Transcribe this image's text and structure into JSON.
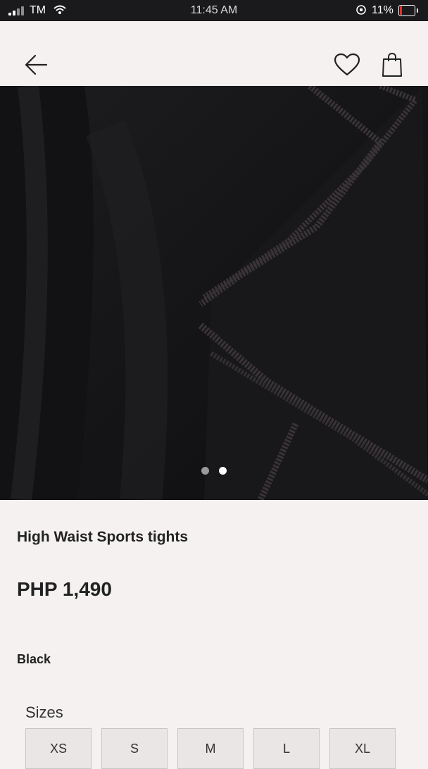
{
  "status_bar": {
    "carrier": "TM",
    "time": "11:45 AM",
    "battery": "11%"
  },
  "header": {
    "back_icon": "arrow-left-icon",
    "wishlist_icon": "heart-icon",
    "bag_icon": "shopping-bag-icon"
  },
  "gallery": {
    "image_count": 2,
    "active_index": 1
  },
  "product": {
    "name": "High Waist Sports tights",
    "price": "PHP 1,490",
    "color": "Black"
  },
  "sizes": {
    "label": "Sizes",
    "options": [
      "XS",
      "S",
      "M",
      "L",
      "XL"
    ]
  },
  "colors": {
    "background": "#f4f1f0",
    "image_bg": "#141416",
    "text": "#222222",
    "size_button_bg": "#e9e6e5"
  }
}
